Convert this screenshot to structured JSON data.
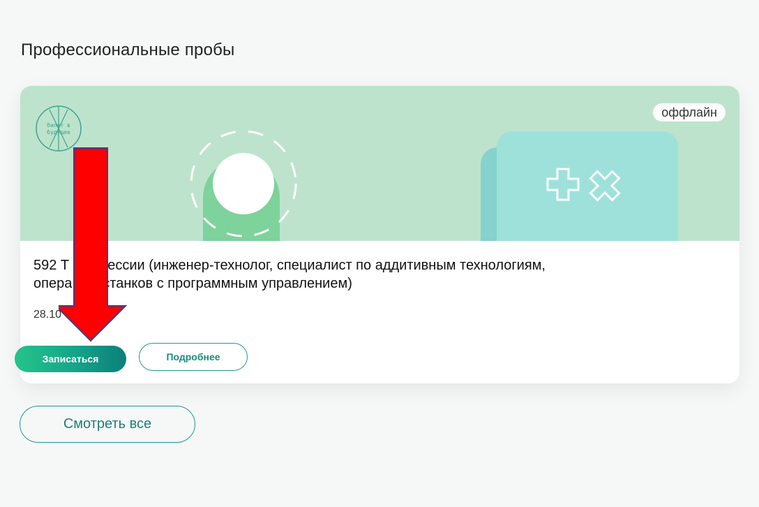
{
  "section": {
    "title": "Профессиональные пробы"
  },
  "card": {
    "badge": "оффлайн",
    "title": "592 Т… профессии (инженер-технолог, специалист по аддитивным технологиям, опера…ров станков с программным управлением)",
    "title_line1": "592 Т   профессии (инженер-технолог, специалист по аддитивным технологиям,",
    "title_line2": "опера   ров станков с программным управлением)",
    "date": "28.10",
    "logo_text": "билет в будущее",
    "buttons": {
      "signup": "Записаться",
      "details": "Подробнее"
    },
    "colors": {
      "banner": "#bde3cd",
      "accent": "#1e9a8c"
    }
  },
  "footer": {
    "see_all": "Смотреть все"
  },
  "annotation": {
    "type": "red-arrow",
    "points_to": "signup-button",
    "color": "#ff0000"
  }
}
